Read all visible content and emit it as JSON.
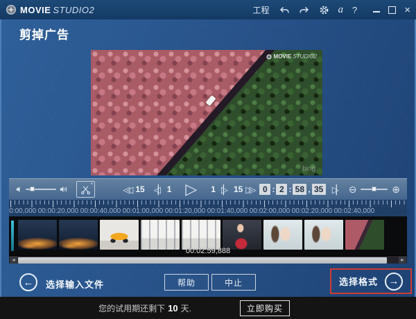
{
  "titlebar": {
    "brand_movie": "MOVIE",
    "brand_studio": "STUDIO2",
    "project": "工程",
    "account": "a",
    "help": "?",
    "close": "×"
  },
  "page": {
    "title": "剪掉广告"
  },
  "preview": {
    "watermark_movie": "MOVIE",
    "watermark_studio": "STUDIO2",
    "bing": "bing"
  },
  "controls": {
    "back15_icon": "◁◁",
    "back15_num": "15",
    "back1_icon": "◁▏",
    "back1_num": "1",
    "play_icon": "▷",
    "fwd1_num": "1",
    "fwd1_icon": "▕▷",
    "fwd15_num": "15",
    "fwd15_icon": "▷▷",
    "end_icon": "▷▏",
    "zoom_out": "⊖",
    "zoom_in": "⊕",
    "scissors_plus": "+",
    "timecode": {
      "h": "0",
      "sep1": ":",
      "m": "2",
      "sep2": ":",
      "s": "58",
      "sep3": ",",
      "ms": "35"
    }
  },
  "ruler": {
    "labels": [
      "00:00:00,000",
      "00:00:20,000",
      "00:00:40,000",
      "00:01:00,000",
      "00:01:20,000",
      "00:01:40,000",
      "00:02:00,000",
      "00:02:20,000",
      "00:02:40,000"
    ]
  },
  "timeline": {
    "current_time": "00:02:59,888",
    "thumbs": [
      {
        "kind": "night-city"
      },
      {
        "kind": "night-city"
      },
      {
        "kind": "yellow-car"
      },
      {
        "kind": "showroom"
      },
      {
        "kind": "showroom"
      },
      {
        "kind": "woman-red"
      },
      {
        "kind": "portrait"
      },
      {
        "kind": "portrait"
      },
      {
        "kind": "pink-forest"
      }
    ]
  },
  "scrollbar": {
    "left_arrow": "◄",
    "right_arrow": "►"
  },
  "footer": {
    "back_arrow": "←",
    "back_label": "选择输入文件",
    "help_label": "帮助",
    "abort_label": "中止",
    "next_label": "选择格式",
    "next_arrow": "→"
  },
  "trial": {
    "prefix": "您的试用期还剩下",
    "days": "10",
    "suffix": "天.",
    "buy_label": "立即购买"
  },
  "colors": {
    "annotation_red": "#d23b32",
    "window_border": "#4e80b6"
  }
}
